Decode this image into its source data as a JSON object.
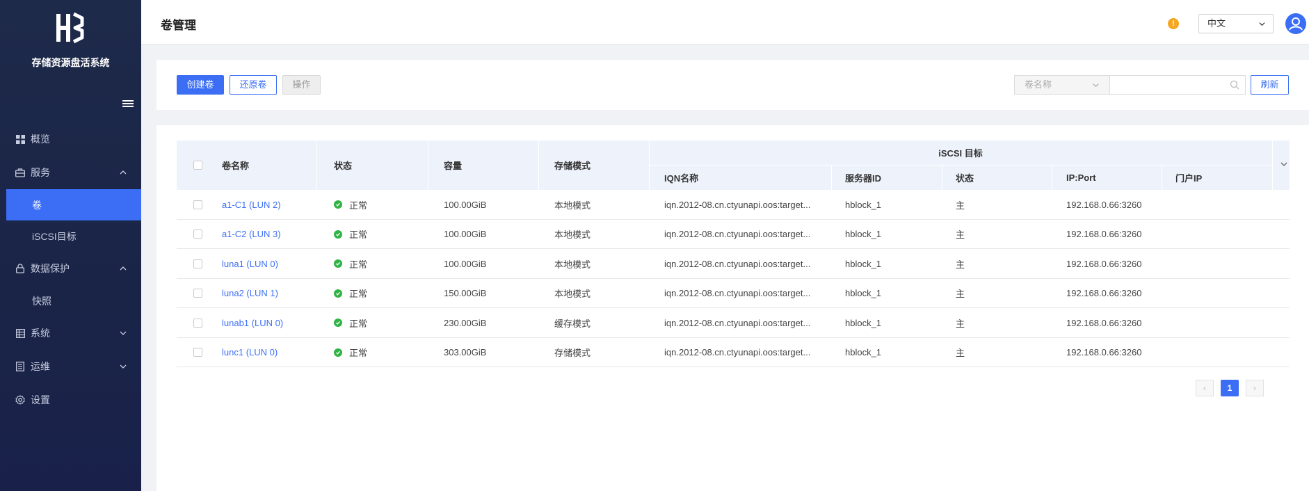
{
  "sidebar": {
    "brand": "存储资源盘活系统",
    "menu": [
      {
        "label": "概览",
        "icon": "grid-icon"
      },
      {
        "label": "服务",
        "icon": "briefcase-icon",
        "expanded": true,
        "children": [
          {
            "label": "卷",
            "active": true
          },
          {
            "label": "iSCSI目标"
          }
        ]
      },
      {
        "label": "数据保护",
        "icon": "lock-icon",
        "expanded": true,
        "children": [
          {
            "label": "快照"
          }
        ]
      },
      {
        "label": "系统",
        "icon": "server-icon",
        "expanded": false
      },
      {
        "label": "运维",
        "icon": "document-icon",
        "expanded": false
      },
      {
        "label": "设置",
        "icon": "gear-icon"
      }
    ]
  },
  "header": {
    "title": "卷管理",
    "language": "中文",
    "alert": "!"
  },
  "toolbar": {
    "create_label": "创建卷",
    "restore_label": "还原卷",
    "action_label": "操作",
    "search_type": "卷名称",
    "search_value": "",
    "refresh_label": "刷新"
  },
  "table": {
    "headers": {
      "name": "卷名称",
      "status": "状态",
      "capacity": "容量",
      "storage_mode": "存储模式",
      "iscsi_group": "iSCSI 目标",
      "iqn": "IQN名称",
      "server_id": "服务器ID",
      "target_status": "状态",
      "ip_port": "IP:Port",
      "portal_ip": "门户IP"
    },
    "rows": [
      {
        "name": "a1-C1 (LUN 2)",
        "status": "正常",
        "capacity": "100.00GiB",
        "mode": "本地模式",
        "iqn": "iqn.2012-08.cn.ctyunapi.oos:target...",
        "server": "hblock_1",
        "tstatus": "主",
        "ip": "192.168.0.66:3260",
        "portal": ""
      },
      {
        "name": "a1-C2 (LUN 3)",
        "status": "正常",
        "capacity": "100.00GiB",
        "mode": "本地模式",
        "iqn": "iqn.2012-08.cn.ctyunapi.oos:target...",
        "server": "hblock_1",
        "tstatus": "主",
        "ip": "192.168.0.66:3260",
        "portal": ""
      },
      {
        "name": "luna1 (LUN 0)",
        "status": "正常",
        "capacity": "100.00GiB",
        "mode": "本地模式",
        "iqn": "iqn.2012-08.cn.ctyunapi.oos:target...",
        "server": "hblock_1",
        "tstatus": "主",
        "ip": "192.168.0.66:3260",
        "portal": ""
      },
      {
        "name": "luna2 (LUN 1)",
        "status": "正常",
        "capacity": "150.00GiB",
        "mode": "本地模式",
        "iqn": "iqn.2012-08.cn.ctyunapi.oos:target...",
        "server": "hblock_1",
        "tstatus": "主",
        "ip": "192.168.0.66:3260",
        "portal": ""
      },
      {
        "name": "lunab1 (LUN 0)",
        "status": "正常",
        "capacity": "230.00GiB",
        "mode": "缓存模式",
        "iqn": "iqn.2012-08.cn.ctyunapi.oos:target...",
        "server": "hblock_1",
        "tstatus": "主",
        "ip": "192.168.0.66:3260",
        "portal": ""
      },
      {
        "name": "lunc1 (LUN 0)",
        "status": "正常",
        "capacity": "303.00GiB",
        "mode": "存储模式",
        "iqn": "iqn.2012-08.cn.ctyunapi.oos:target...",
        "server": "hblock_1",
        "tstatus": "主",
        "ip": "192.168.0.66:3260",
        "portal": ""
      }
    ]
  },
  "pagination": {
    "current": "1",
    "prev": "‹",
    "next": "›"
  },
  "colors": {
    "primary": "#3b6ef5",
    "sidebar_bg": "#1e2a4a",
    "status_ok": "#2fb344",
    "alert": "#f5a623"
  }
}
